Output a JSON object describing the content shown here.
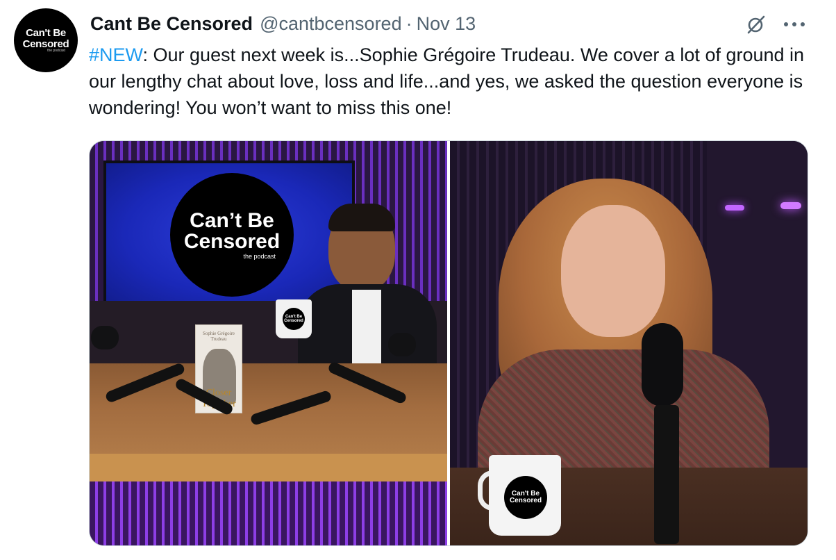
{
  "tweet": {
    "avatar": {
      "line1": "Can't Be",
      "line2": "Censored",
      "line3": "the podcast"
    },
    "author_name": "Cant Be Censored",
    "handle": "@cantbcensored",
    "separator": "·",
    "date": "Nov 13",
    "text_hashtag": "#NEW",
    "text_body": ": Our guest next week is...Sophie Grégoire Trudeau. We cover a lot of ground in our lengthy chat about love, loss and life...and yes, we asked the question everyone is wondering! You won’t want to miss this one!",
    "icons": {
      "grok": "grok-icon",
      "more": "more-icon"
    },
    "colors": {
      "link": "#1d9bf0",
      "secondary": "#536471",
      "text": "#0f1419"
    }
  },
  "media": {
    "left": {
      "screen_logo": {
        "line1": "Can’t Be",
        "line2": "Censored",
        "line3": "the podcast"
      },
      "mug_label": "Can't Be Censored",
      "book": {
        "author": "Sophie Grégoire Trudeau",
        "title": "Closer Together"
      }
    },
    "right": {
      "mug_label": {
        "line1": "Can't Be",
        "line2": "Censored"
      }
    }
  }
}
